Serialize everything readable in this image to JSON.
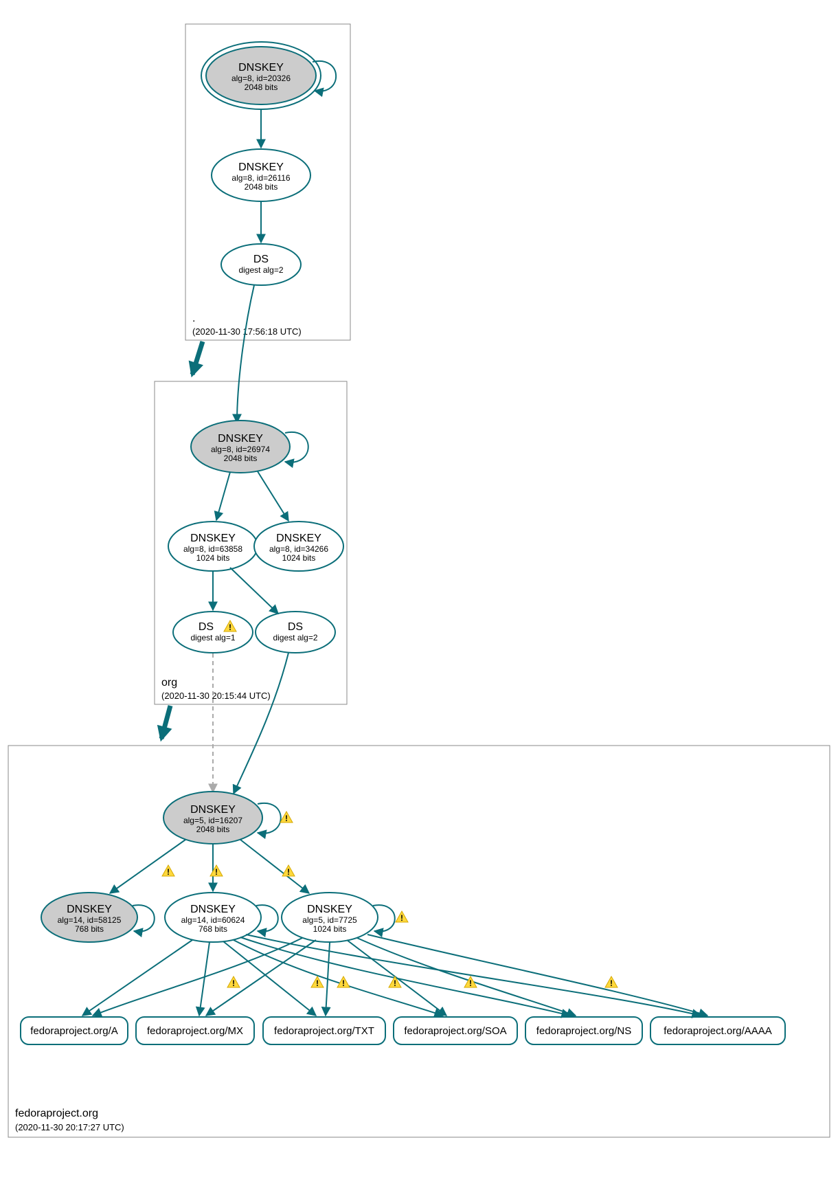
{
  "zones": {
    "root": {
      "label": ".",
      "time": "(2020-11-30 17:56:18 UTC)"
    },
    "org": {
      "label": "org",
      "time": "(2020-11-30 20:15:44 UTC)"
    },
    "fedora": {
      "label": "fedoraproject.org",
      "time": "(2020-11-30 20:17:27 UTC)"
    }
  },
  "nodes": {
    "root_ksk": {
      "title": "DNSKEY",
      "l1": "alg=8, id=20326",
      "l2": "2048 bits"
    },
    "root_zsk": {
      "title": "DNSKEY",
      "l1": "alg=8, id=26116",
      "l2": "2048 bits"
    },
    "root_ds": {
      "title": "DS",
      "l1": "digest alg=2"
    },
    "org_ksk": {
      "title": "DNSKEY",
      "l1": "alg=8, id=26974",
      "l2": "2048 bits"
    },
    "org_zsk1": {
      "title": "DNSKEY",
      "l1": "alg=8, id=63858",
      "l2": "1024 bits"
    },
    "org_zsk2": {
      "title": "DNSKEY",
      "l1": "alg=8, id=34266",
      "l2": "1024 bits"
    },
    "org_ds1": {
      "title": "DS",
      "l1": "digest alg=1"
    },
    "org_ds2": {
      "title": "DS",
      "l1": "digest alg=2"
    },
    "fed_ksk": {
      "title": "DNSKEY",
      "l1": "alg=5, id=16207",
      "l2": "2048 bits"
    },
    "fed_k1": {
      "title": "DNSKEY",
      "l1": "alg=14, id=58125",
      "l2": "768 bits"
    },
    "fed_k2": {
      "title": "DNSKEY",
      "l1": "alg=14, id=60624",
      "l2": "768 bits"
    },
    "fed_k3": {
      "title": "DNSKEY",
      "l1": "alg=5, id=7725",
      "l2": "1024 bits"
    }
  },
  "rrsets": {
    "a": "fedoraproject.org/A",
    "mx": "fedoraproject.org/MX",
    "txt": "fedoraproject.org/TXT",
    "soa": "fedoraproject.org/SOA",
    "ns": "fedoraproject.org/NS",
    "aaaa": "fedoraproject.org/AAAA"
  }
}
